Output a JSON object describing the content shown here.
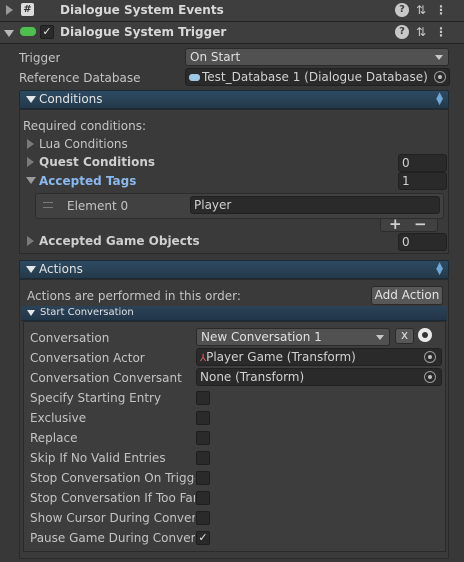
{
  "components": [
    {
      "title": "Dialogue System Events",
      "icon": "script-hash-icon",
      "has_checkbox": false
    },
    {
      "title": "Dialogue System Trigger",
      "icon": "green-component-icon",
      "has_checkbox": true,
      "checked": true
    }
  ],
  "header_icons": {
    "help": "?",
    "settings": "⇅",
    "menu": "⋮"
  },
  "trigger": {
    "label": "Trigger",
    "value": "On Start"
  },
  "reference_database": {
    "label": "Reference Database",
    "value": "Test_Database 1 (Dialogue Database)"
  },
  "conditions": {
    "title": "Conditions",
    "required_label": "Required conditions:",
    "lua_label": "Lua Conditions",
    "quest_label": "Quest Conditions",
    "quest_value": "0",
    "accepted_tags_label": "Accepted Tags",
    "accepted_tags_value": "1",
    "element_label": "Element 0",
    "element_value": "Player",
    "plus": "+",
    "minus": "−",
    "accepted_objects_label": "Accepted Game Objects",
    "accepted_objects_value": "0"
  },
  "actions": {
    "title": "Actions",
    "order_label": "Actions are performed in this order:",
    "add_action": "Add Action",
    "start_conversation": {
      "title": "Start Conversation",
      "conversation_label": "Conversation",
      "conversation_value": "New Conversation 1",
      "clear_button": "x",
      "actor_label": "Conversation Actor",
      "actor_value": "Player Game (Transform)",
      "conversant_label": "Conversation Conversant",
      "conversant_value": "None (Transform)",
      "toggles": [
        {
          "label": "Specify Starting Entry",
          "checked": false
        },
        {
          "label": "Exclusive",
          "checked": false
        },
        {
          "label": "Replace",
          "checked": false
        },
        {
          "label": "Skip If No Valid Entries",
          "checked": false
        },
        {
          "label": "Stop Conversation On Trigger",
          "checked": false
        },
        {
          "label": "Stop Conversation If Too Far",
          "checked": false
        },
        {
          "label": "Show Cursor During Conversation",
          "checked": false
        },
        {
          "label": "Pause Game During Conversation",
          "checked": true
        }
      ]
    }
  },
  "colors": {
    "accent_blue": "#6fa7d6",
    "section_bar": "#2e4b62",
    "panel": "#3a3a3a",
    "background": "#383838"
  }
}
